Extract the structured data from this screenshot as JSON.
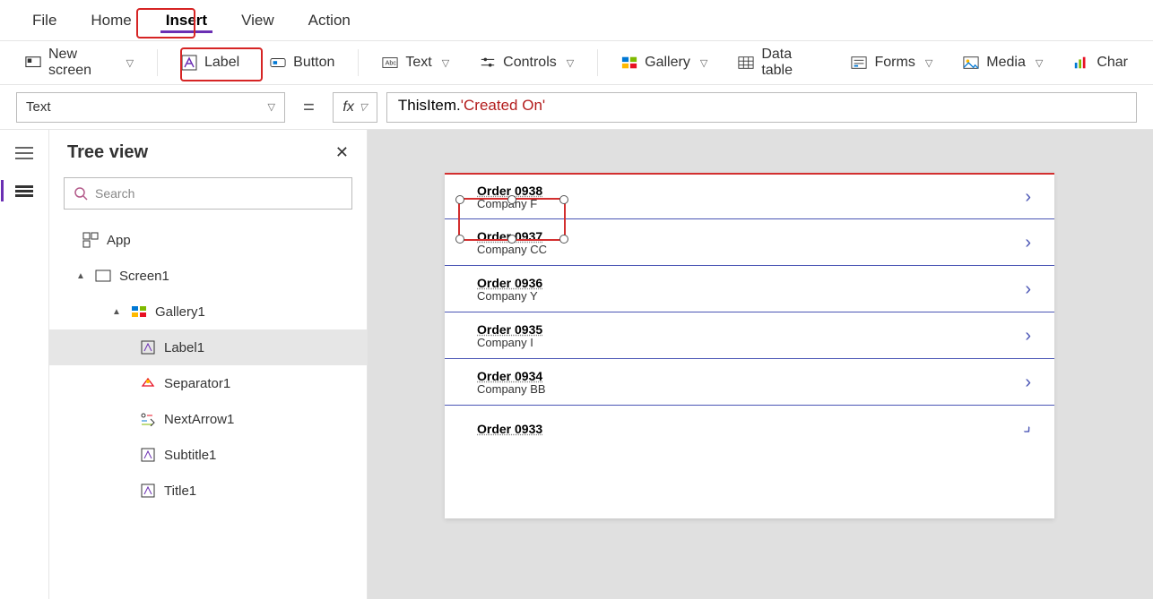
{
  "menubar": {
    "items": [
      {
        "label": "File"
      },
      {
        "label": "Home"
      },
      {
        "label": "Insert",
        "active": true
      },
      {
        "label": "View"
      },
      {
        "label": "Action"
      }
    ]
  },
  "ribbon": {
    "new_screen": "New screen",
    "label": "Label",
    "button": "Button",
    "text": "Text",
    "controls": "Controls",
    "gallery": "Gallery",
    "data_table": "Data table",
    "forms": "Forms",
    "media": "Media",
    "charts": "Char"
  },
  "formula": {
    "property": "Text",
    "token1": "ThisItem",
    "dot": ".",
    "token2": "'Created On'"
  },
  "tree": {
    "title": "Tree view",
    "search_placeholder": "Search",
    "app": "App",
    "screen": "Screen1",
    "gallery": "Gallery1",
    "label": "Label1",
    "separator": "Separator1",
    "arrow": "NextArrow1",
    "subtitle": "Subtitle1",
    "title_item": "Title1"
  },
  "gallery_rows": [
    {
      "title": "Order 0938",
      "subtitle": "Company F"
    },
    {
      "title": "Order 0937",
      "subtitle": "Company CC"
    },
    {
      "title": "Order 0936",
      "subtitle": "Company Y"
    },
    {
      "title": "Order 0935",
      "subtitle": "Company I"
    },
    {
      "title": "Order 0934",
      "subtitle": "Company BB"
    },
    {
      "title": "Order 0933",
      "subtitle": ""
    }
  ]
}
